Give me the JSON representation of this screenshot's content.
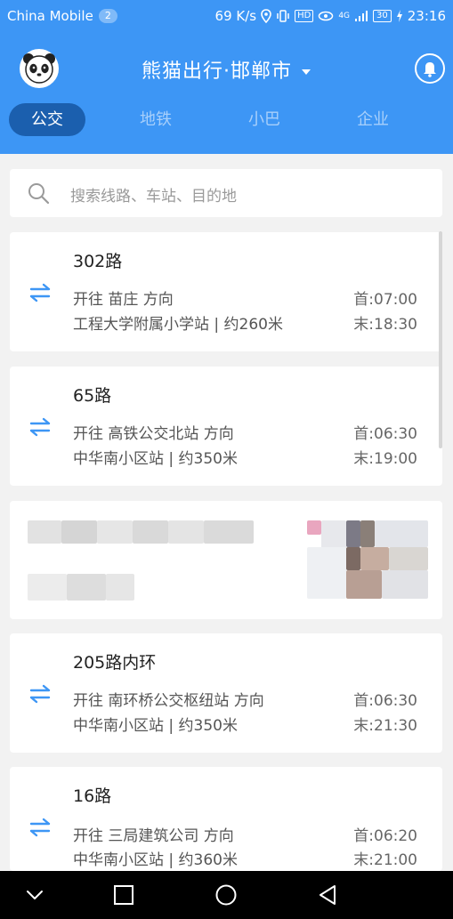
{
  "status_bar": {
    "carrier": "China Mobile",
    "sim_slot": "2",
    "speed": "69 K/s",
    "hd_label": "HD",
    "network_label": "4G",
    "battery": "30",
    "time": "23:16"
  },
  "header": {
    "title": "熊猫出行·邯郸市",
    "background_color": "#3d96f5",
    "active_tab_color": "#1b5fae"
  },
  "tabs": [
    {
      "label": "公交",
      "active": true
    },
    {
      "label": "地铁",
      "active": false
    },
    {
      "label": "小巴",
      "active": false
    },
    {
      "label": "企业",
      "active": false
    }
  ],
  "search": {
    "placeholder": "搜索线路、车站、目的地"
  },
  "routes": [
    {
      "name": "302路",
      "direction": "开往 苗庄 方向",
      "stop": "工程大学附属小学站 | 约260米",
      "first": "首:07:00",
      "last": "末:18:30"
    },
    {
      "name": "65路",
      "direction": "开往 高铁公交北站 方向",
      "stop": "中华南小区站 | 约350米",
      "first": "首:06:30",
      "last": "末:19:00"
    },
    {
      "name": "205路内环",
      "direction": "开往 南环桥公交枢纽站 方向",
      "stop": "中华南小区站 | 约350米",
      "first": "首:06:30",
      "last": "末:21:30"
    },
    {
      "name": "16路",
      "direction": "开往 三局建筑公司 方向",
      "stop": "中华南小区站 | 约360米",
      "first": "首:06:20",
      "last": "末:21:00"
    }
  ],
  "icons": {
    "swap": "swap-arrows-icon",
    "search": "search-icon",
    "bell": "bell-icon",
    "avatar": "panda-avatar-icon",
    "dropdown": "caret-down-icon"
  }
}
